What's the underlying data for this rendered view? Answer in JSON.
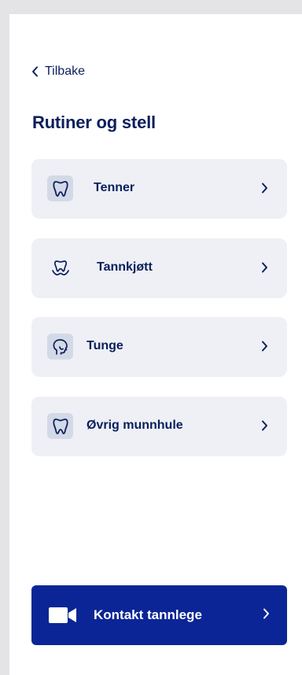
{
  "nav": {
    "back_label": "Tilbake"
  },
  "page": {
    "title": "Rutiner og stell"
  },
  "items": [
    {
      "label": "Tenner",
      "icon": "tooth-icon"
    },
    {
      "label": "Tannkjøtt",
      "icon": "gums-icon"
    },
    {
      "label": "Tunge",
      "icon": "tongue-head-icon"
    },
    {
      "label": "Øvrig munnhule",
      "icon": "tooth-icon"
    }
  ],
  "cta": {
    "label": "Kontakt tannlege",
    "icon": "video-camera-icon"
  },
  "colors": {
    "primary": "#0a1f5c",
    "accent": "#0b2596",
    "card_bg": "#eef0f5",
    "icon_bg": "#d3d9e6"
  }
}
